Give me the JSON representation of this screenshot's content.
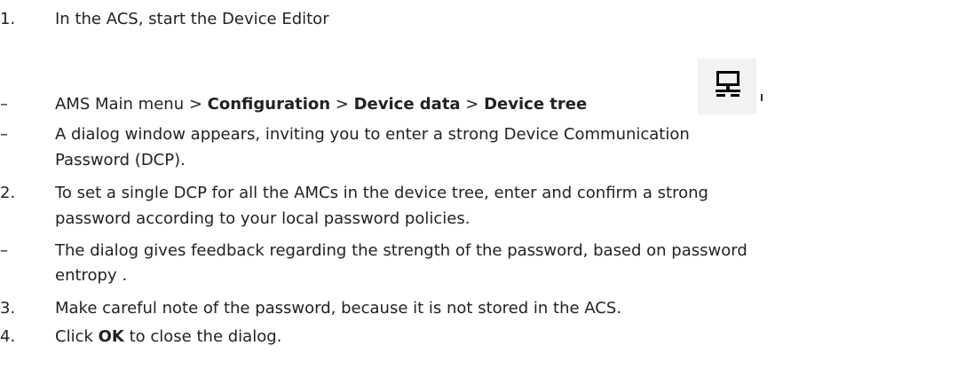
{
  "steps": [
    {
      "marker": "1.",
      "text": "In the ACS, start the Device Editor"
    },
    {
      "marker": "–",
      "parts": {
        "p1": "AMS Main menu > ",
        "b1": "Configuration",
        "p2": " > ",
        "b2": "Device data",
        "p3": " > ",
        "b3": "Device tree"
      }
    },
    {
      "marker": "–",
      "line1": "A dialog window appears, inviting you to enter a strong Device Communication",
      "line2": "Password (DCP)."
    },
    {
      "marker": "2.",
      "line1": "To set a single DCP for all the AMCs in the device tree, enter and confirm a strong",
      "line2": "password according to your local password policies."
    },
    {
      "marker": "–",
      "line1": "The dialog gives feedback regarding the strength of the password, based on password",
      "line2": "entropy ."
    },
    {
      "marker": "3.",
      "text": "Make careful note of the password, because it is not stored in the ACS."
    },
    {
      "marker": "4.",
      "pre": "Click ",
      "bold": "OK",
      "post": " to close the dialog."
    }
  ],
  "icon": "device-tree-icon"
}
